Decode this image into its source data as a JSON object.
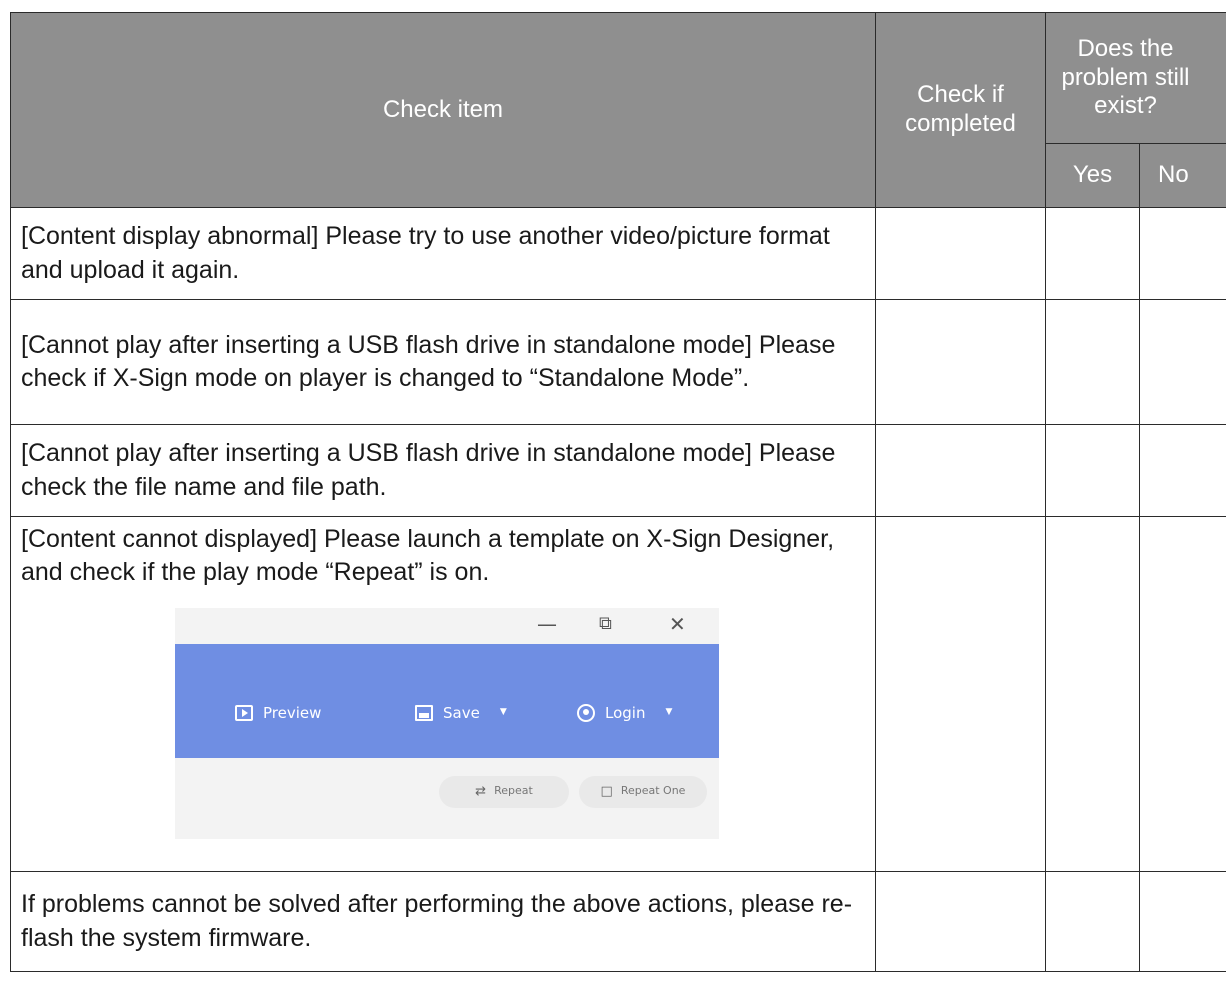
{
  "header": {
    "check_item": "Check item",
    "check_if_completed": "Check if completed",
    "still_exist": "Does the problem still exist?",
    "yes": "Yes",
    "no": "No"
  },
  "rows": [
    {
      "text": "[Content display abnormal] Please try to use another video/picture format and upload it again."
    },
    {
      "text": "[Cannot play after inserting a USB flash drive in standalone mode] Please check if X-Sign mode on player is changed to “Standalone Mode”."
    },
    {
      "text": "[Cannot play after inserting a USB flash drive in standalone mode] Please check the file name and file path."
    },
    {
      "text": "[Content cannot displayed] Please launch a template on X-Sign Designer, and check if the play mode “Repeat” is on."
    },
    {
      "text": "If problems cannot be solved after performing the above actions, please re-flash the system firmware."
    }
  ],
  "designer": {
    "window_controls": {
      "minimize": "—",
      "restore": "⧉",
      "close": "✕"
    },
    "toolbar": {
      "preview": "Preview",
      "save": "Save",
      "login": "Login"
    },
    "play_modes": {
      "repeat": "Repeat",
      "repeat_one": "Repeat One"
    },
    "toolbar_color": "#6f8ee3"
  },
  "colors": {
    "header_bg": "#8f8f8f",
    "border": "#2b2b2b"
  }
}
